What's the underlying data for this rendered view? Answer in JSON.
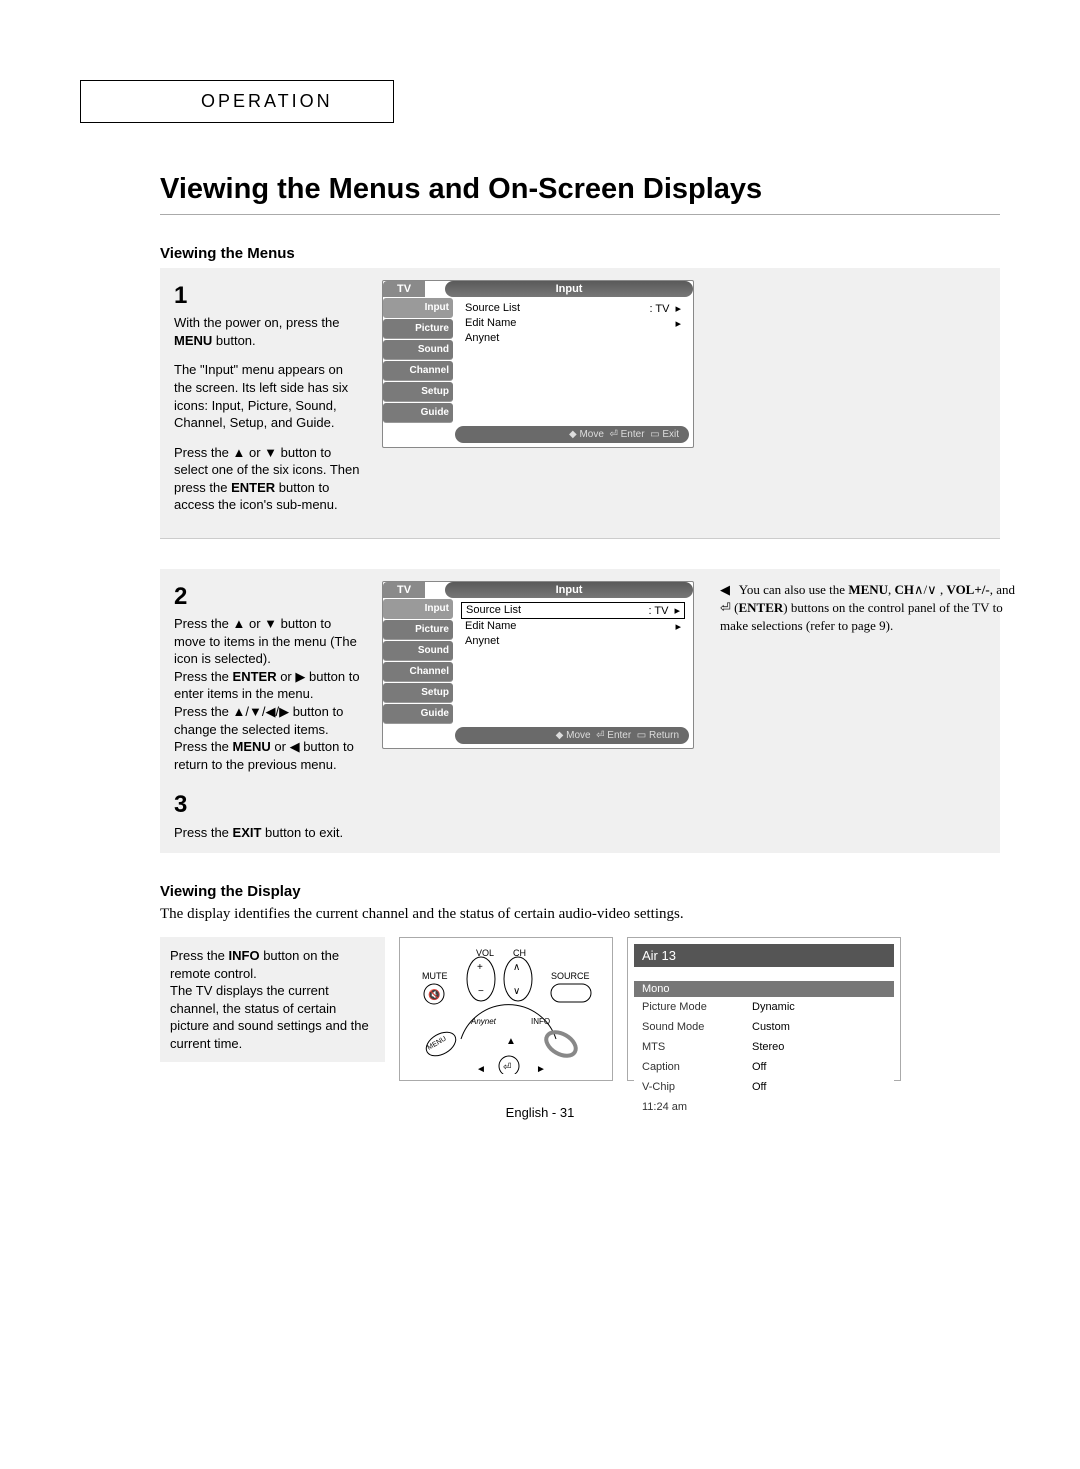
{
  "operation_label": "OPERATION",
  "main_title": "Viewing the Menus and On-Screen Displays",
  "sec1_title": "Viewing the Menus",
  "step1": {
    "num": "1",
    "p1a": "With the power on, press the ",
    "p1b": "MENU",
    "p1c": " button.",
    "p2": "The \"Input\" menu appears on the screen. Its left side has six icons: Input, Picture, Sound, Channel, Setup, and Guide.",
    "p3a": "Press the ▲ or ▼ button to select one of the six icons. Then press the ",
    "p3b": "ENTER",
    "p3c": " button to access the icon's sub-menu."
  },
  "step2": {
    "num": "2",
    "p1": "Press the ▲ or ▼ button to move to items in the menu (The icon is selected).",
    "p2a": "Press the ",
    "p2b": "ENTER",
    "p2c": " or ▶ button to enter items in the menu.",
    "p3": "Press the ▲/▼/◀/▶ button to change the selected items.",
    "p4a": "Press the ",
    "p4b": "MENU",
    "p4c": " or ◀ button to return to the previous menu."
  },
  "step3": {
    "num": "3",
    "p1a": "Press the ",
    "p1b": "EXIT",
    "p1c": " button to exit."
  },
  "osd": {
    "tv_label": "TV",
    "title": "Input",
    "tabs": [
      "Input",
      "Picture",
      "Sound",
      "Channel",
      "Setup",
      "Guide"
    ],
    "rows": [
      {
        "label": "Source List",
        "value": ": TV",
        "arrow": true
      },
      {
        "label": "Edit Name",
        "value": "",
        "arrow": true
      },
      {
        "label": "Anynet",
        "value": "",
        "arrow": false
      }
    ],
    "footer1": {
      "move": "Move",
      "enter": "Enter",
      "exit": "Exit"
    },
    "footer2": {
      "move": "Move",
      "enter": "Enter",
      "exit": "Return"
    }
  },
  "side_note": {
    "l1a": "You can also use the ",
    "l1b": "MENU",
    "l1c": ",",
    "l2a": "CH",
    "l2b": " , ",
    "l2c": "VOL+/-",
    "l2d": ", and",
    "l3a": "(",
    "l3b": "ENTER",
    "l3c": ") buttons on the control panel of the TV to make selections (refer to page 9)."
  },
  "sec2_title": "Viewing the Display",
  "display_intro": "The display identifies the current channel and the status of certain audio-video settings.",
  "display_left": {
    "a": "Press the ",
    "b": "INFO",
    "c": " button on the remote control.",
    "d": "The TV displays the current channel, the status of certain picture and sound settings and the current time."
  },
  "remote_labels": {
    "vol": "VOL",
    "ch": "CH",
    "mute": "MUTE",
    "source": "SOURCE",
    "info": "INFO",
    "menu": "MENU",
    "anynet": "Anynet"
  },
  "info_panel": {
    "header": "Air  13",
    "sub": "Mono",
    "rows": [
      {
        "k": "Picture Mode",
        "v": "Dynamic"
      },
      {
        "k": "Sound Mode",
        "v": "Custom"
      },
      {
        "k": "MTS",
        "v": "Stereo"
      },
      {
        "k": "Caption",
        "v": "Off"
      },
      {
        "k": "V-Chip",
        "v": "Off"
      },
      {
        "k": "11:24 am",
        "v": ""
      }
    ]
  },
  "footer": "English - 31"
}
